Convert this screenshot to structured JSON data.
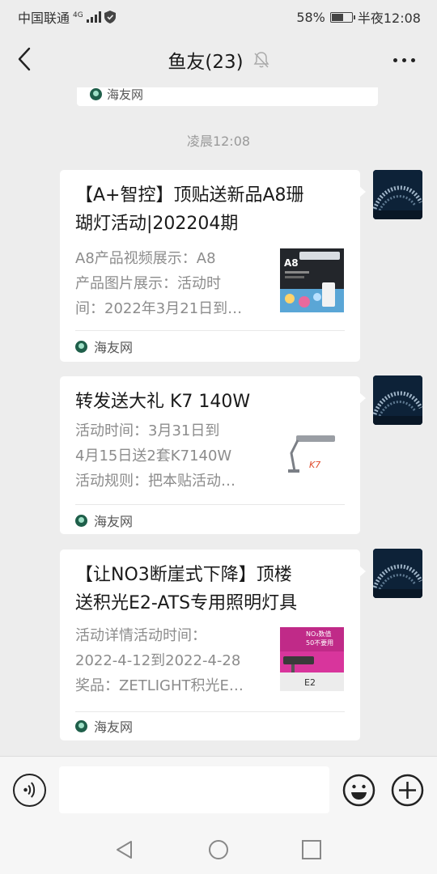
{
  "status_bar": {
    "carrier": "中国联通",
    "network": "4G",
    "battery": "58%",
    "battery_level": 0.58,
    "time": "半夜12:08"
  },
  "header": {
    "title": "鱼友(23)"
  },
  "chat": {
    "previous_source": "海友网",
    "time_label": "凌晨12:08",
    "messages": [
      {
        "title": "【A+智控】顶贴送新品A8珊瑚灯活动|202204期",
        "title_lines": [
          "【A+智控】顶贴送新品A8珊",
          "瑚灯活动|202204期"
        ],
        "desc_lines": [
          "A8产品视频展示：A8",
          "产品图片展示：活动时",
          "间：2022年3月21日到…"
        ],
        "thumb_text": "A8",
        "source": "海友网"
      },
      {
        "title": "转发送大礼 K7 140W",
        "title_lines": [
          "转发送大礼 K7 140W"
        ],
        "desc_lines": [
          "活动时间：3月31日到",
          "4月15日送2套K7140W",
          "活动规则：把本贴活动…"
        ],
        "thumb_text": "K7",
        "source": "海友网"
      },
      {
        "title": "【让NO3断崖式下降】顶楼送积光E2-ATS专用照明灯具",
        "title_lines": [
          "【让NO3断崖式下降】顶楼",
          "送积光E2-ATS专用照明灯具"
        ],
        "desc_lines": [
          "活动详情活动时间：",
          "2022-4-12到2022-4-28",
          "奖品：ZETLIGHT积光E…"
        ],
        "thumb_text_1": "NO₃数值",
        "thumb_text_2": "50不要用",
        "thumb_text_3": "E2",
        "source": "海友网"
      }
    ]
  },
  "input_bar": {
    "placeholder": ""
  },
  "colors": {
    "background": "#ededed",
    "card": "#ffffff",
    "secondary_text": "#8c8c8c",
    "time_label": "#9a9a9a"
  },
  "icons": [
    "back-arrow-icon",
    "mute-bell-icon",
    "more-dots-icon",
    "voice-icon",
    "emoji-icon",
    "plus-icon",
    "nav-back-icon",
    "nav-home-icon",
    "nav-recents-icon"
  ]
}
